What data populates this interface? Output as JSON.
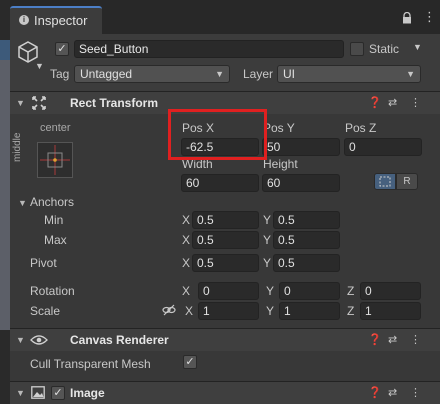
{
  "tab": {
    "title": "Inspector"
  },
  "header": {
    "object_name": "Seed_Button",
    "static_label": "Static",
    "tag_label": "Tag",
    "tag_value": "Untagged",
    "layer_label": "Layer",
    "layer_value": "UI"
  },
  "rect_transform": {
    "title": "Rect Transform",
    "anchor_preset_label": "center",
    "anchor_preset_side": "middle",
    "pos_x_label": "Pos X",
    "pos_x": "-62.5",
    "pos_y_label": "Pos Y",
    "pos_y": "50",
    "pos_z_label": "Pos Z",
    "pos_z": "0",
    "width_label": "Width",
    "width": "60",
    "height_label": "Height",
    "height": "60",
    "raw_btn": "R",
    "anchors_label": "Anchors",
    "min_label": "Min",
    "min_x": "0.5",
    "min_y": "0.5",
    "max_label": "Max",
    "max_x": "0.5",
    "max_y": "0.5",
    "pivot_label": "Pivot",
    "pivot_x": "0.5",
    "pivot_y": "0.5",
    "rotation_label": "Rotation",
    "rot_x": "0",
    "rot_y": "0",
    "rot_z": "0",
    "scale_label": "Scale",
    "scale_x": "1",
    "scale_y": "1",
    "scale_z": "1",
    "x": "X",
    "y": "Y",
    "z": "Z"
  },
  "canvas_renderer": {
    "title": "Canvas Renderer",
    "cull_label": "Cull Transparent Mesh"
  },
  "image": {
    "title": "Image"
  },
  "colors": {
    "highlight": "#e02020",
    "accent": "#4c7fc7"
  }
}
